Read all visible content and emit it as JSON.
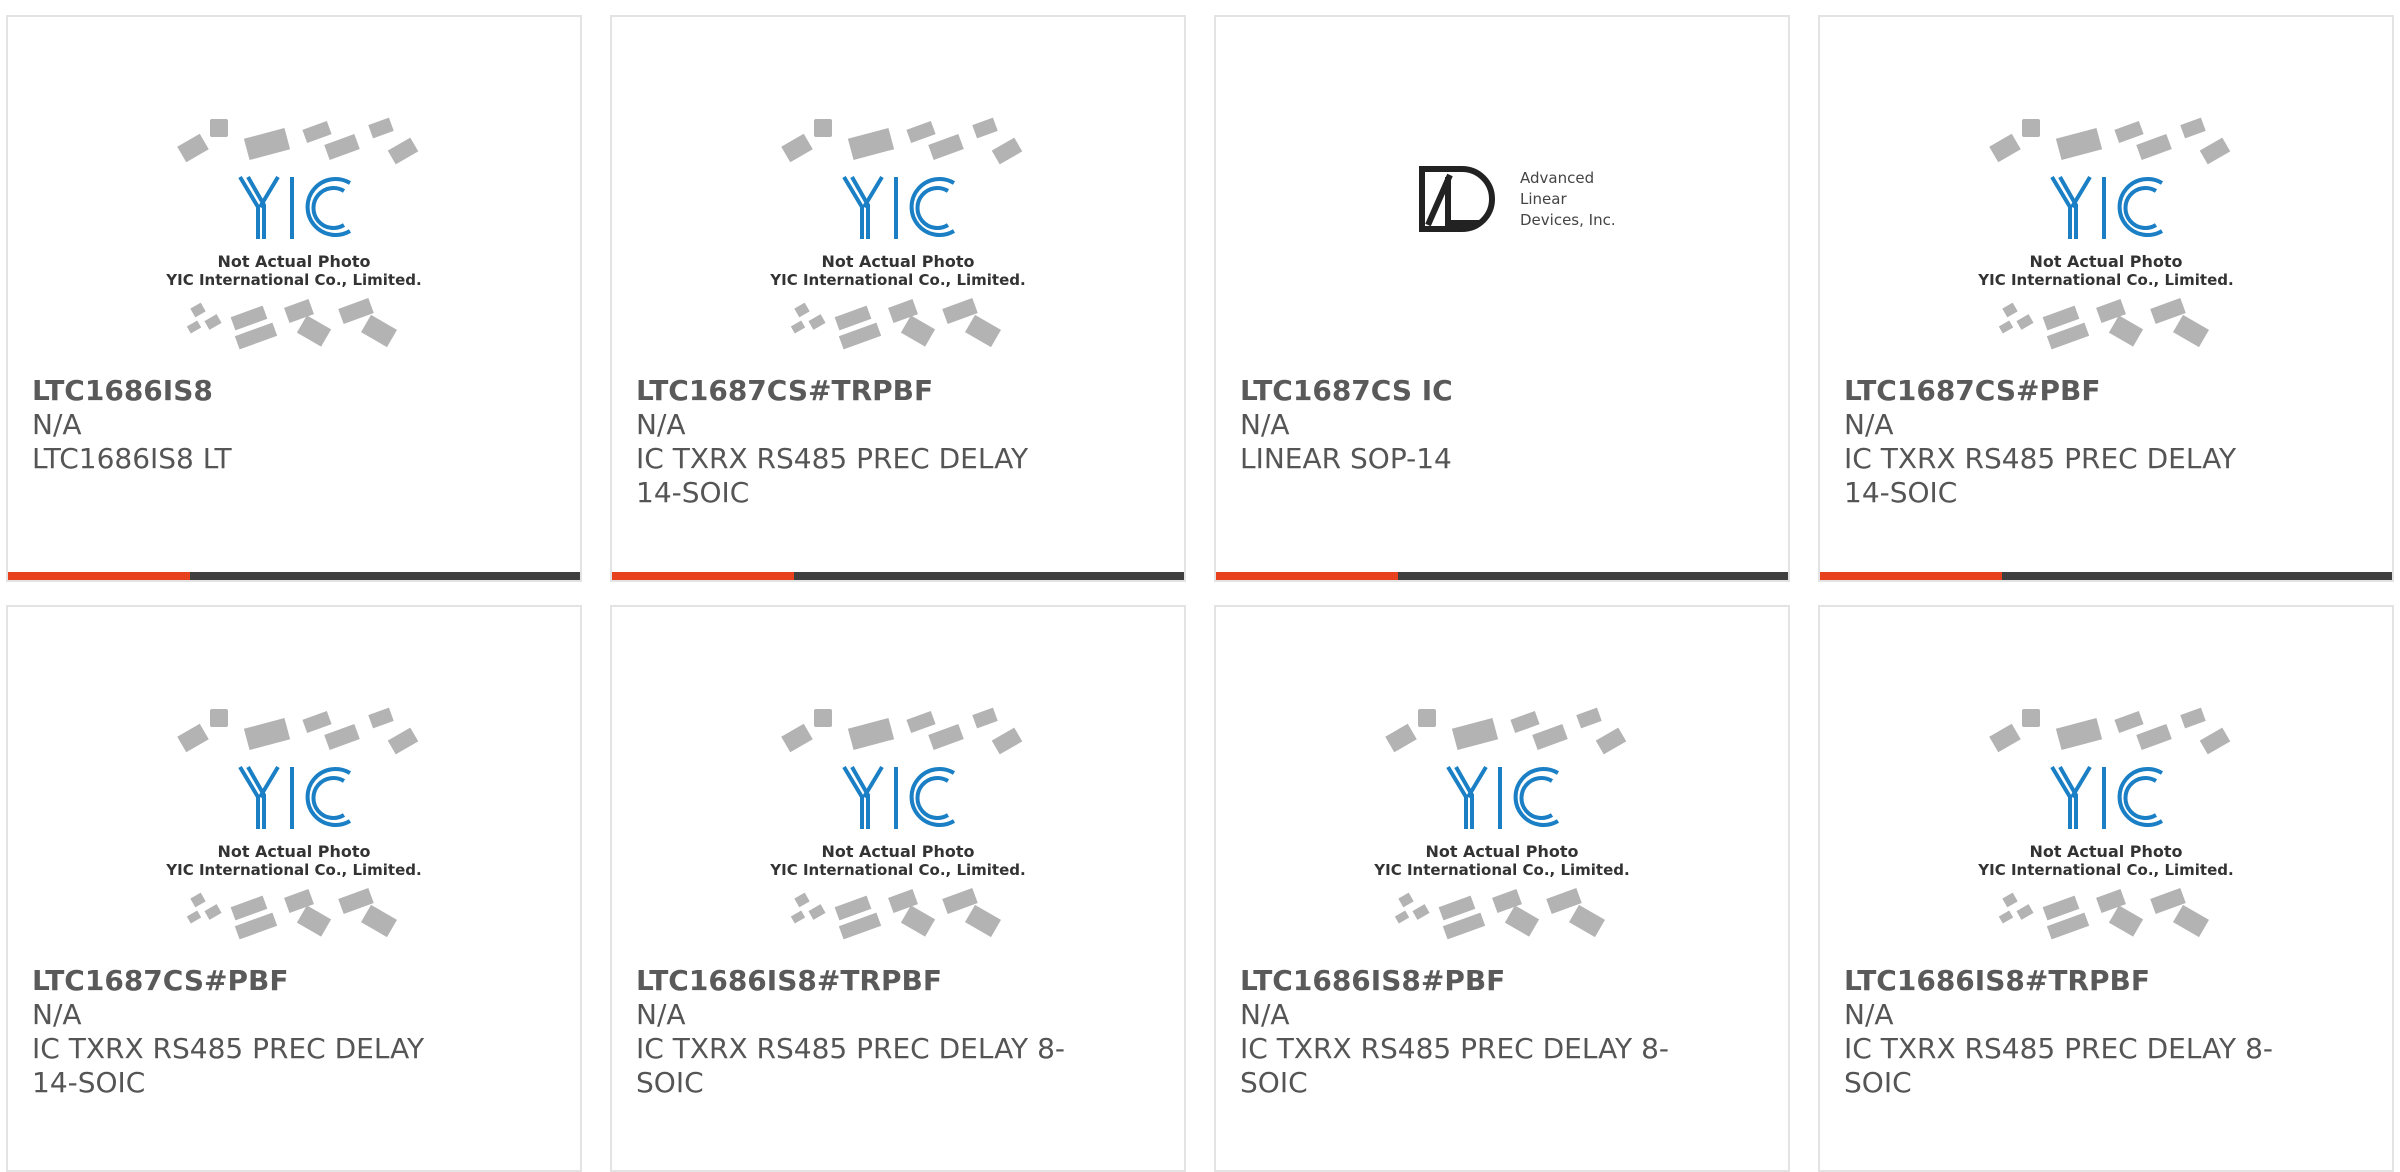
{
  "products": [
    {
      "part": "LTC1686IS8",
      "availability": "N/A",
      "description": "LTC1686IS8 LT",
      "image": "yic-placeholder-icon",
      "image_caption": [
        "Not Actual Photo",
        "YIC International Co., Limited."
      ]
    },
    {
      "part": "LTC1687CS#TRPBF",
      "availability": "N/A",
      "description": "IC TXRX RS485 PREC DELAY 14-SOIC",
      "image": "yic-placeholder-icon",
      "image_caption": [
        "Not Actual Photo",
        "YIC International Co., Limited."
      ]
    },
    {
      "part": "LTC1687CS IC",
      "availability": "N/A",
      "description": "LINEAR SOP-14",
      "image": "advanced-linear-devices-logo",
      "logo_text": [
        "Advanced",
        "Linear",
        "Devices, Inc."
      ]
    },
    {
      "part": "LTC1687CS#PBF",
      "availability": "N/A",
      "description": "IC TXRX RS485 PREC DELAY 14-SOIC",
      "image": "yic-placeholder-icon",
      "image_caption": [
        "Not Actual Photo",
        "YIC International Co., Limited."
      ]
    },
    {
      "part": "LTC1687CS#PBF",
      "availability": "N/A",
      "description": "IC TXRX RS485 PREC DELAY 14-SOIC",
      "image": "yic-placeholder-icon",
      "image_caption": [
        "Not Actual Photo",
        "YIC International Co., Limited."
      ]
    },
    {
      "part": "LTC1686IS8#TRPBF",
      "availability": "N/A",
      "description": "IC TXRX RS485 PREC DELAY 8-SOIC",
      "image": "yic-placeholder-icon",
      "image_caption": [
        "Not Actual Photo",
        "YIC International Co., Limited."
      ]
    },
    {
      "part": "LTC1686IS8#PBF",
      "availability": "N/A",
      "description": "IC TXRX RS485 PREC DELAY 8-SOIC",
      "image": "yic-placeholder-icon",
      "image_caption": [
        "Not Actual Photo",
        "YIC International Co., Limited."
      ]
    },
    {
      "part": "LTC1686IS8#TRPBF",
      "availability": "N/A",
      "description": "IC TXRX RS485 PREC DELAY 8-SOIC",
      "image": "yic-placeholder-icon",
      "image_caption": [
        "Not Actual Photo",
        "YIC International Co., Limited."
      ]
    }
  ],
  "colors": {
    "accent": "#e8411e",
    "bar": "#3f3f3f",
    "border": "#e3e3e3",
    "text": "#555555",
    "logo_blue": "#1a7fc4"
  }
}
